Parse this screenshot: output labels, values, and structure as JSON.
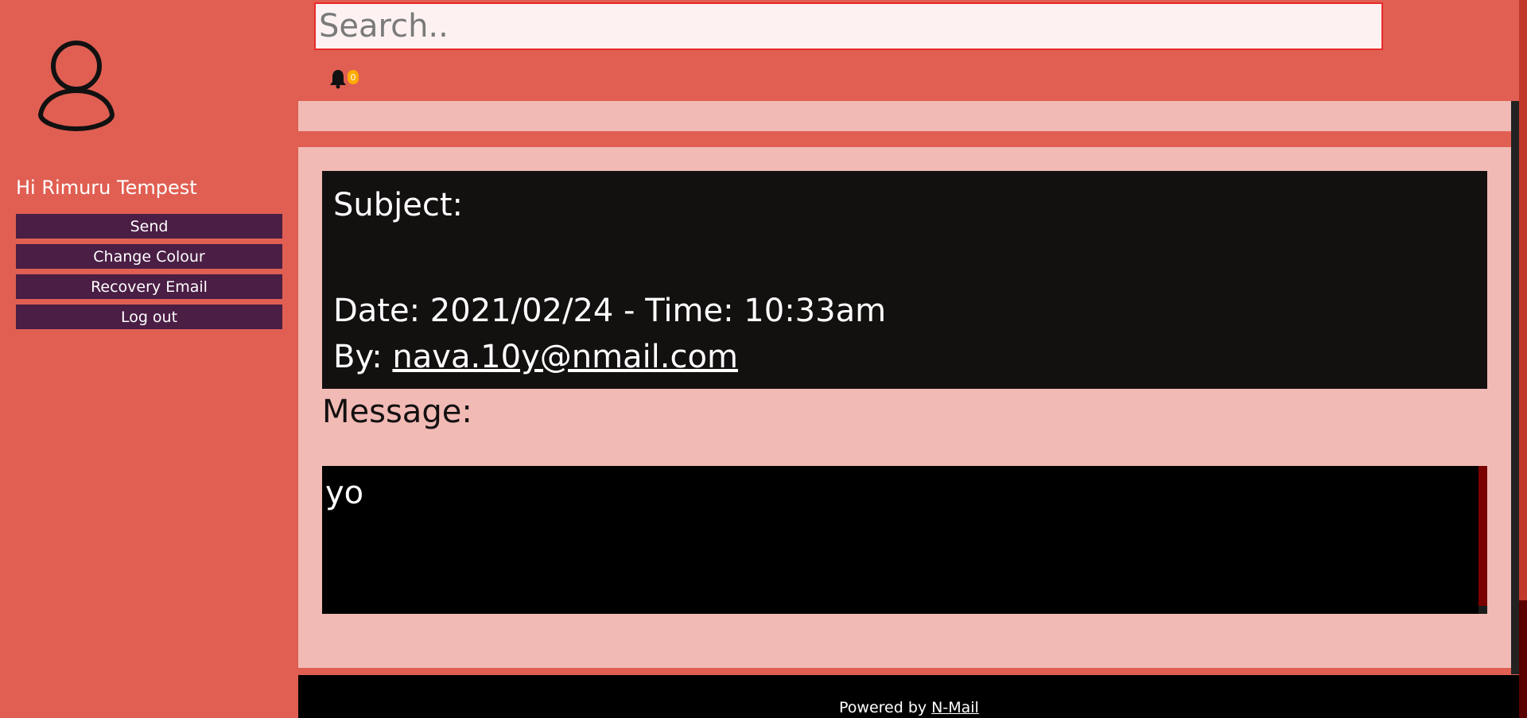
{
  "user": {
    "greeting": "Hi Rimuru Tempest",
    "avatar_icon": "user-icon"
  },
  "menu": {
    "items": [
      {
        "label": "Send"
      },
      {
        "label": "Change Colour"
      },
      {
        "label": "Recovery Email"
      },
      {
        "label": "Log out"
      }
    ]
  },
  "search": {
    "placeholder": "Search..",
    "value": ""
  },
  "notifications": {
    "icon": "bell-icon",
    "count": "0"
  },
  "email": {
    "subject_label": "Subject:",
    "date_text": "Date: 2021/02/24 - Time: 10:33am",
    "by_label": "By: ",
    "sender": "nava.10y@nmail.com",
    "message_label": "Message:",
    "message": "yo"
  },
  "footer": {
    "prefix": "Powered by ",
    "link": "N-Mail"
  },
  "colors": {
    "background": "#e05f52",
    "panel": "#f1bab5",
    "button": "#4a1e45",
    "header_box": "#131010",
    "message_box": "#000000",
    "search_border": "#e82a2a",
    "badge": "#ffab00"
  }
}
